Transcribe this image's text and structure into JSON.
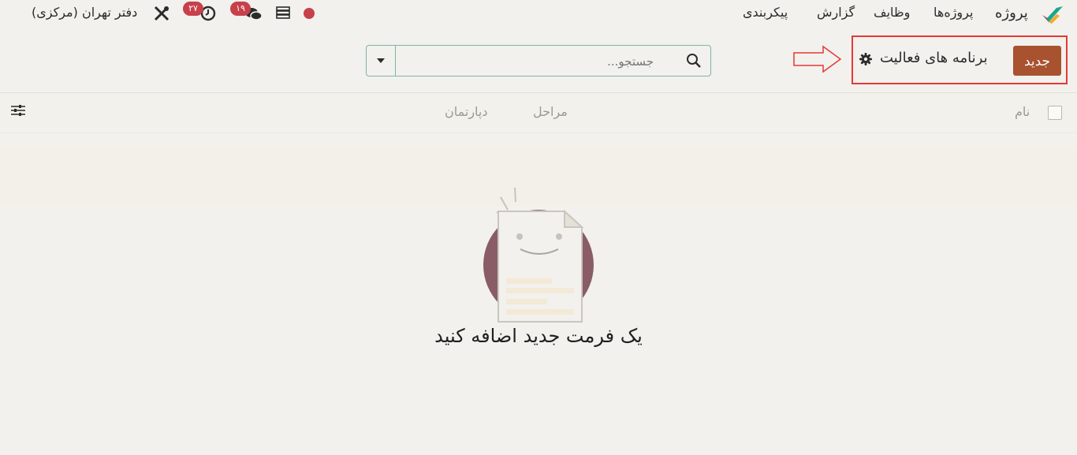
{
  "navbar": {
    "app_name": "پروژه",
    "menu": [
      "پروژه‌ها",
      "وظایف",
      "گزارش",
      "پیکربندی"
    ],
    "company": "دفتر تهران (مرکزی)",
    "activity_count": "۲۷",
    "messages_count": "۱۹"
  },
  "control_panel": {
    "new_label": "جدید",
    "breadcrumb": "برنامه های فعالیت",
    "search_placeholder": "جستجو..."
  },
  "list": {
    "columns": [
      "نام",
      "مراحل",
      "دپارتمان"
    ]
  },
  "empty_state": {
    "title": "یک فرمت جدید اضافه کنید"
  },
  "colors": {
    "brand": "#a85230",
    "badge": "#c8404a",
    "highlight": "#e53935",
    "status_dot": "#c8404a"
  }
}
